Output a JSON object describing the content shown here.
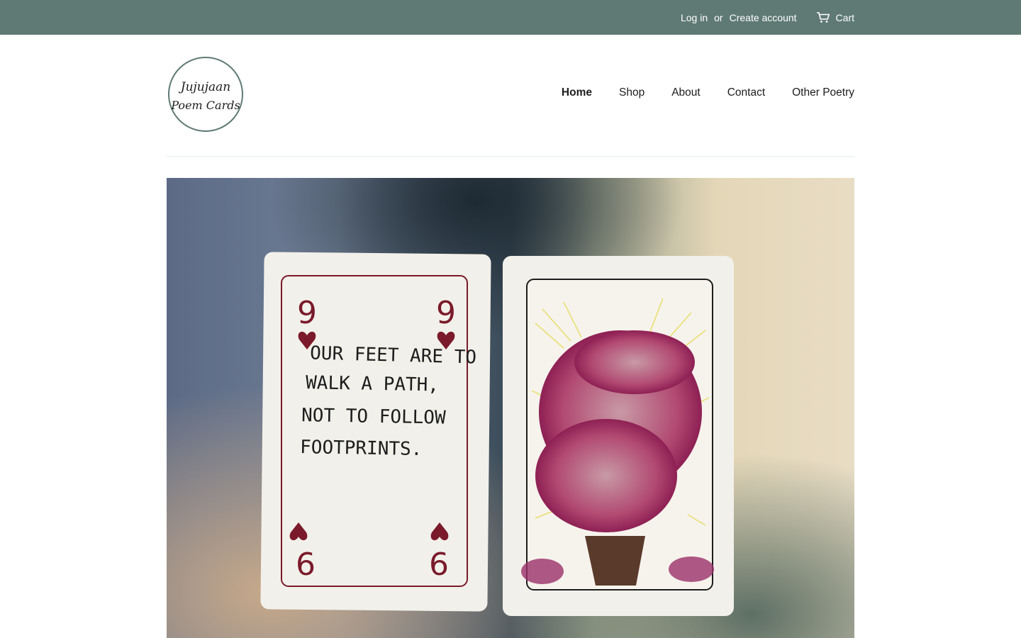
{
  "topbar": {
    "login": "Log in",
    "or": "or",
    "create_account": "Create account",
    "cart": "Cart"
  },
  "logo": {
    "line1": "Jujujaan",
    "line2": "Poem Cards"
  },
  "nav": {
    "items": [
      {
        "label": "Home",
        "active": true
      },
      {
        "label": "Shop",
        "active": false
      },
      {
        "label": "About",
        "active": false
      },
      {
        "label": "Contact",
        "active": false
      },
      {
        "label": "Other Poetry",
        "active": false
      }
    ]
  },
  "hero": {
    "card_rank": "9",
    "poem_lines": [
      "OUR FEET ARE TO",
      "WALK A PATH,",
      "NOT TO FOLLOW",
      "FOOTPRINTS."
    ]
  },
  "colors": {
    "topbar": "#5f7a74",
    "ink": "#7a1a2a",
    "text": "#1c1d1d"
  }
}
